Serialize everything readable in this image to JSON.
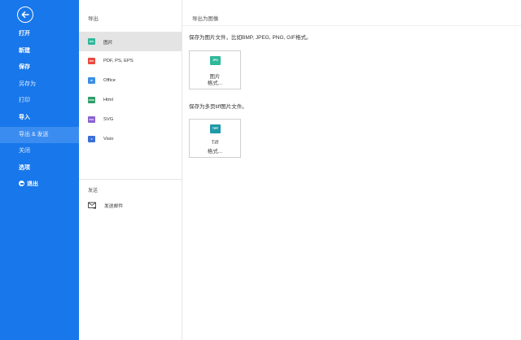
{
  "sidebar": {
    "items": [
      {
        "label": "打开",
        "style": "bold"
      },
      {
        "label": "新建",
        "style": "bold"
      },
      {
        "label": "保存",
        "style": "bold"
      },
      {
        "label": "另存为",
        "style": "light"
      },
      {
        "label": "打印",
        "style": "light"
      },
      {
        "label": "导入",
        "style": "bold"
      },
      {
        "label": "导出 & 发送",
        "style": "light",
        "active": true
      },
      {
        "label": "关闭",
        "style": "light"
      },
      {
        "label": "选项",
        "style": "bold"
      },
      {
        "label": "退出",
        "style": "bold",
        "icon": "exit-icon"
      }
    ]
  },
  "middle": {
    "export_heading": "导出",
    "export_items": [
      {
        "label": "图片",
        "icon_text": "JPG",
        "icon_color": "#2fb89a",
        "selected": true
      },
      {
        "label": "PDF, PS, EPS",
        "icon_text": "PDF",
        "icon_color": "#e8493f"
      },
      {
        "label": "Office",
        "icon_text": "W",
        "icon_color": "#3b8ee6"
      },
      {
        "label": "Html",
        "icon_text": "HTML",
        "icon_color": "#2f9e6a"
      },
      {
        "label": "SVG",
        "icon_text": "SVG",
        "icon_color": "#8a63d2"
      },
      {
        "label": "Visio",
        "icon_text": "V",
        "icon_color": "#3b6fd8"
      }
    ],
    "send_heading": "发送",
    "send_item": {
      "label": "发送邮件",
      "icon": "mail-icon"
    }
  },
  "right": {
    "heading": "导出为图像",
    "section1": {
      "description": "保存为图片文件，比如BMP, JPEG, PNG, GIF格式。",
      "card": {
        "icon_text": "JPG",
        "icon_color": "#2fb89a",
        "line1": "图片",
        "line2": "格式..."
      }
    },
    "section2": {
      "description": "保存为多页tiff图片文件。",
      "card": {
        "icon_text": "TIFF",
        "icon_color": "#1f9aa8",
        "line1": "Tiff",
        "line2": "格式..."
      }
    }
  },
  "colors": {
    "sidebar_bg": "#1877ea",
    "active_item_bg": "#3b8cf0",
    "selected_row_bg": "#e4e4e4"
  }
}
